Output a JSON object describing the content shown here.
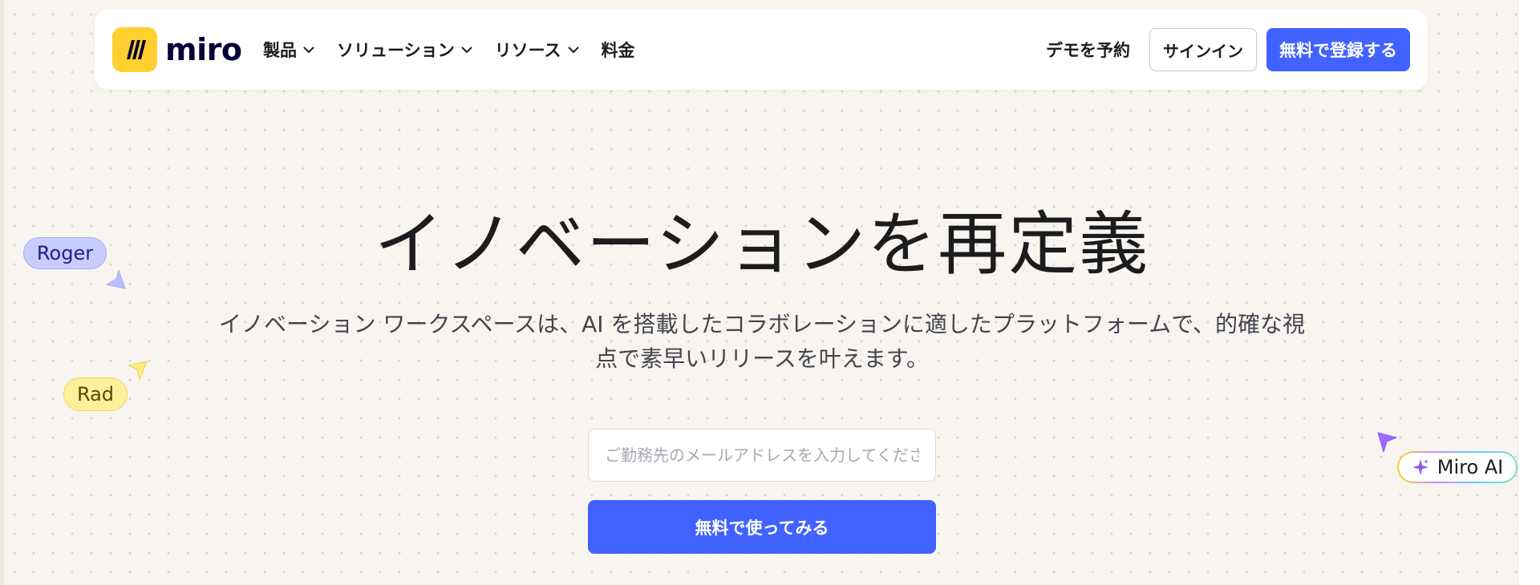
{
  "brand": {
    "name": "miro",
    "accent": "#4262ff",
    "logo_bg": "#ffd02f"
  },
  "nav": {
    "menu": [
      {
        "label": "製品",
        "has_dropdown": true
      },
      {
        "label": "ソリューション",
        "has_dropdown": true
      },
      {
        "label": "リソース",
        "has_dropdown": true
      },
      {
        "label": "料金",
        "has_dropdown": false
      }
    ],
    "demo_label": "デモを予約",
    "signin_label": "サインイン",
    "signup_label": "無料で登録する"
  },
  "hero": {
    "title": "イノベーションを再定義",
    "subtitle": "イノベーション ワークスペースは、AI を搭載したコラボレーションに適したプラットフォームで、的確な視点で素早いリリースを叶えます。",
    "email_placeholder": "ご勤務先のメールアドレスを入力してください",
    "email_value": "",
    "cta_label": "無料で使ってみる"
  },
  "cursors": {
    "roger": {
      "name": "Roger",
      "color": "#c9ccff"
    },
    "rad": {
      "name": "Rad",
      "color": "#fff09c"
    },
    "ai": {
      "name": "Miro AI",
      "color": "#9b6bff"
    }
  },
  "icons": {
    "logo": "miro-logo-icon",
    "dropdown": "chevron-down-icon",
    "pointer": "cursor-pointer-icon",
    "sparkle": "sparkle-icon"
  }
}
